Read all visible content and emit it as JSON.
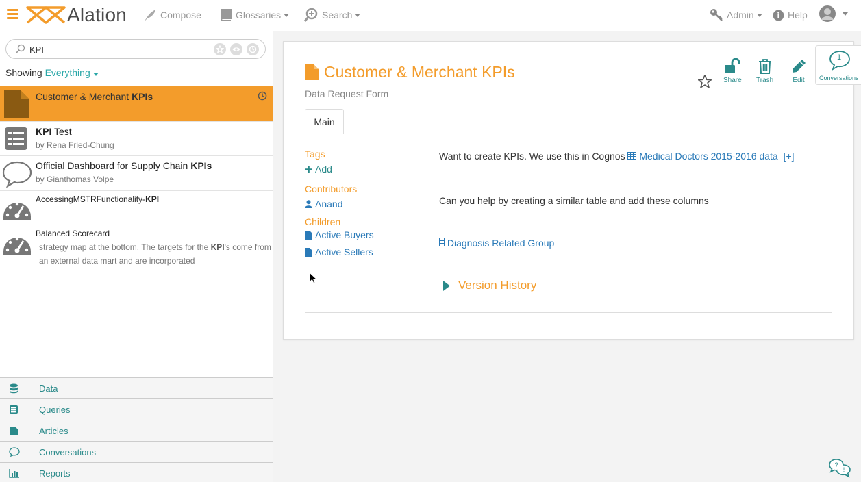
{
  "app": {
    "name": "Alation"
  },
  "nav": {
    "compose": "Compose",
    "glossaries": "Glossaries",
    "search": "Search",
    "admin": "Admin",
    "help": "Help"
  },
  "search": {
    "value": "KPI"
  },
  "showing": {
    "prefix": "Showing",
    "filter": "Everything"
  },
  "results": [
    {
      "title_pre": "Customer & Merchant ",
      "title_bold": "KPIs",
      "title_post": "",
      "icon": "article-icon",
      "active": true
    },
    {
      "title_pre": "",
      "title_bold": "KPI",
      "title_post": " Test",
      "sub": "by Rena Fried-Chung",
      "icon": "query-icon"
    },
    {
      "title_pre": "Official Dashboard for Supply Chain ",
      "title_bold": "KPIs",
      "title_post": "",
      "sub": "by Gianthomas Volpe",
      "icon": "conversation-icon"
    },
    {
      "title_pre": "AccessingMSTRFunctionality-",
      "title_bold": "KPI",
      "title_post": "",
      "icon": "report-gauge-icon"
    },
    {
      "title_pre": "Balanced Scorecard",
      "title_bold": "",
      "title_post": "",
      "snippet_line1_pre": "strategy map at the bottom. The targets for the ",
      "snippet_line1_bold": "KPI",
      "snippet_line1_post": "'s come from",
      "snippet_line2": "an external data mart and are incorporated",
      "icon": "report-gauge-icon"
    }
  ],
  "bottom_nav": [
    {
      "label": "Data",
      "icon": "database-icon"
    },
    {
      "label": "Queries",
      "icon": "queries-icon"
    },
    {
      "label": "Articles",
      "icon": "article-icon"
    },
    {
      "label": "Conversations",
      "icon": "conversation-icon"
    },
    {
      "label": "Reports",
      "icon": "bar-chart-icon"
    }
  ],
  "page": {
    "title": "Customer & Merchant KPIs",
    "subtitle": "Data Request Form",
    "tab": "Main",
    "actions": {
      "share": "Share",
      "trash": "Trash",
      "edit": "Edit"
    },
    "conversations": {
      "count": "1",
      "label": "Conversations"
    },
    "tags_label": "Tags",
    "add_label": "Add",
    "contributors_label": "Contributors",
    "contributor": "Anand",
    "children_label": "Children",
    "children": [
      "Active Buyers",
      "Active Sellers"
    ],
    "body_line1": "Want to create KPIs.  We use this in Cognos",
    "body_link1": "Medical Doctors 2015-2016 data",
    "body_link1_suffix": "[+]",
    "body_line2": "Can you help by creating a similar table and add these columns",
    "body_link2": "Diagnosis Related Group",
    "version_history": "Version History"
  },
  "colors": {
    "accent": "#f39c2b",
    "teal": "#2a8a8a",
    "link": "#2a7ab8"
  }
}
